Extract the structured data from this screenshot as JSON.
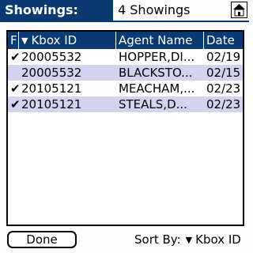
{
  "title": {
    "label": "Showings:",
    "value": "4 Showings",
    "home_icon": "home-icon"
  },
  "table": {
    "columns": [
      {
        "label": "F"
      },
      {
        "label": "Kbox ID",
        "sort_icon": "triangle-down-icon"
      },
      {
        "label": "Agent Name"
      },
      {
        "label": "Date"
      }
    ],
    "rows": [
      {
        "flag": "✔",
        "kbox_id": "20005532",
        "agent": "HOPPER,DI...",
        "date": "02/19",
        "highlight": false
      },
      {
        "flag": "",
        "kbox_id": "20005532",
        "agent": "BLACKSTO...",
        "date": "02/15",
        "highlight": true
      },
      {
        "flag": "✔",
        "kbox_id": "20105121",
        "agent": "MEACHAM,...",
        "date": "02/23",
        "highlight": false
      },
      {
        "flag": "✔",
        "kbox_id": "20105121",
        "agent": "STEALS,D...",
        "date": "02/23",
        "highlight": true
      }
    ]
  },
  "footer": {
    "done_label": "Done",
    "sort_label": "Sort By:",
    "sort_value": "Kbox ID"
  },
  "colors": {
    "header_bg": "#0b3a73",
    "row_highlight": "#d3d3ef"
  }
}
